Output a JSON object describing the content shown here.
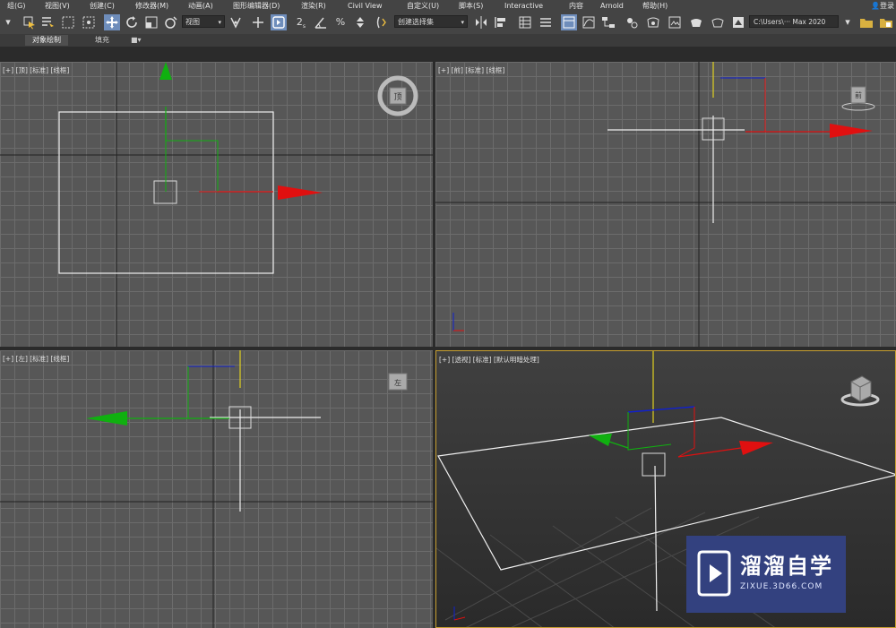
{
  "menu": {
    "items": [
      "组(G)",
      "视图(V)",
      "创建(C)",
      "修改器(M)",
      "动画(A)",
      "图形编辑器(D)",
      "渲染(R)",
      "Civil View",
      "自定义(U)",
      "脚本(S)",
      "Interactive",
      "内容",
      "Arnold",
      "帮助(H)"
    ],
    "login": "登录"
  },
  "toolbar": {
    "view_dropdown": "视图",
    "selection_set_dropdown": "创建选择集",
    "project_path": "C:\\Users\\··· Max 2020"
  },
  "ribbon": {
    "tabs": [
      "对象绘制",
      "填充"
    ],
    "active_tab": "对象绘制"
  },
  "viewports": {
    "top": {
      "label": "[+] [顶] [标准] [线框]",
      "cube_face": "顶"
    },
    "front": {
      "label": "[+] [前] [标准] [线框]",
      "cube_face": "前"
    },
    "left": {
      "label": "[+] [左] [标准] [线框]",
      "cube_face": "左"
    },
    "perspective": {
      "label": "[+] [透视] [标准] [默认明暗处理]"
    }
  },
  "watermark": {
    "title": "溜溜自学",
    "url": "ZIXUE.3D66.COM"
  },
  "colors": {
    "axis_x": "#e01010",
    "axis_y": "#10b010",
    "axis_z": "#1020d0",
    "active_viewport_border": "#c8a030",
    "watermark_bg": "#33417f"
  }
}
